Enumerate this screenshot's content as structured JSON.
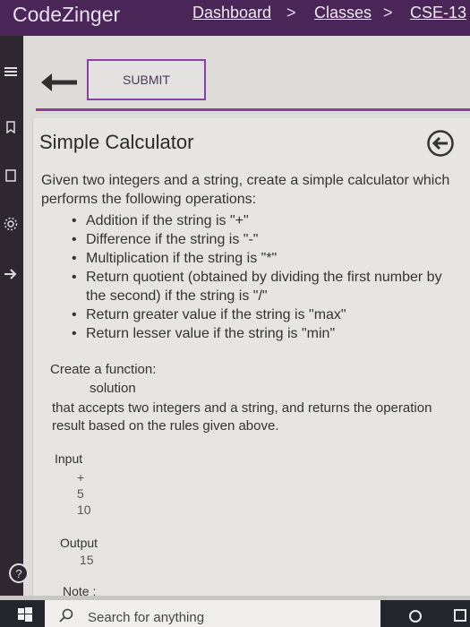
{
  "nav": {
    "brand": "CodeZinger",
    "breadcrumbs": [
      "Dashboard",
      "Classes",
      "CSE-13"
    ],
    "separator": ">"
  },
  "toolbar": {
    "submit_label": "SUBMIT"
  },
  "problem": {
    "title": "Simple Calculator",
    "description": "Given two integers and a string, create a simple calculator which performs the following operations:",
    "operations": [
      "Addition if the string is \"+\"",
      "Difference if the string is \"-\"",
      "Multiplication if the string is \"*\"",
      "Return quotient (obtained by dividing the first number by the second) if the string is \"/\"",
      "Return greater value if the string is \"max\"",
      "Return lesser value if the string is \"min\""
    ],
    "function_heading": "Create a function:",
    "function_name": "solution",
    "function_description": "that accepts two integers and a string, and returns the operation result based on the rules given above.",
    "input_label": "Input",
    "input_values": [
      "+",
      "5",
      "10"
    ],
    "output_label": "Output",
    "output_value": "15",
    "note_label": "Note :"
  },
  "taskbar": {
    "search_placeholder": "Search for anything"
  },
  "icons": {
    "back": "arrow-left-icon",
    "card_back": "circle-arrow-left-icon",
    "help": "question-circle-icon",
    "search": "search-icon",
    "windows": "windows-logo-icon"
  },
  "colors": {
    "nav_bg": "#4a2558",
    "accent": "#8b3fa6",
    "rail_bg": "#2e2730",
    "taskbar_bg": "#23272d"
  }
}
